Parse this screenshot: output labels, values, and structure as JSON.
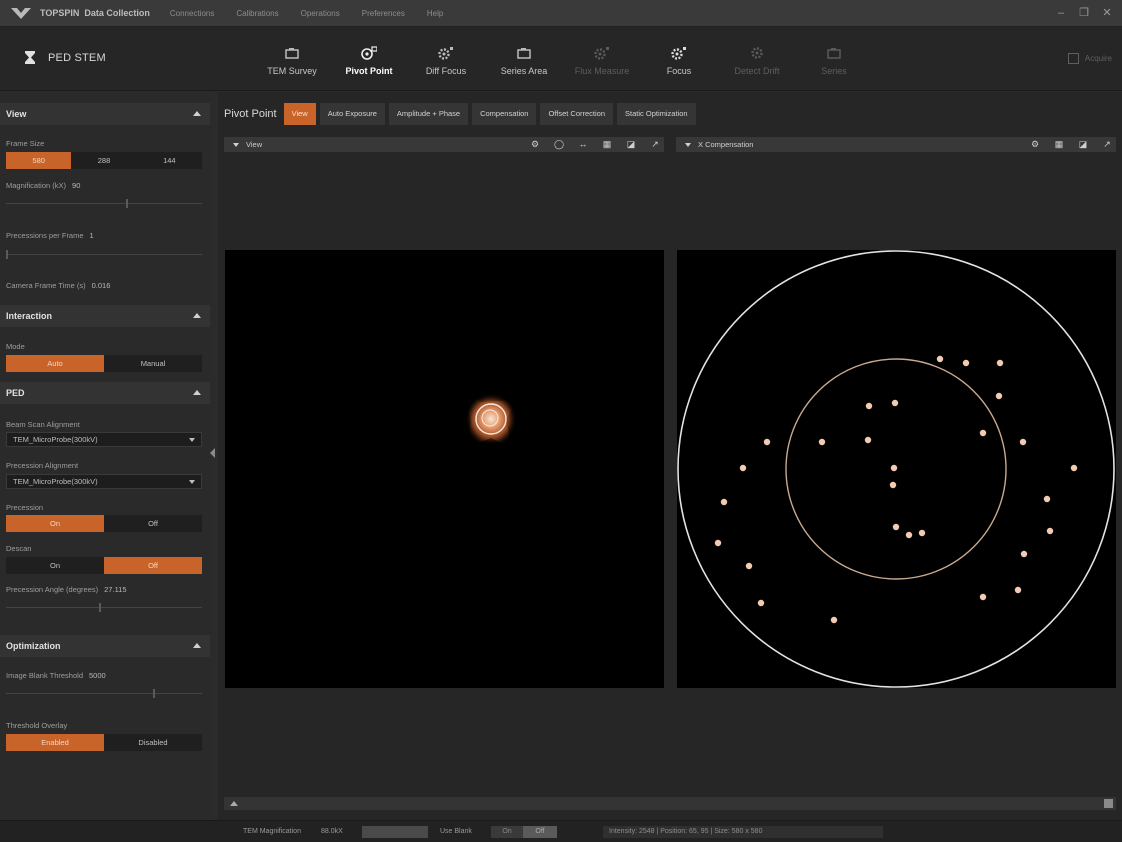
{
  "app": {
    "name": "TOPSPIN",
    "subtitle": "Data Collection"
  },
  "menu": [
    "Connections",
    "Calibrations",
    "Operations",
    "Preferences",
    "Help"
  ],
  "window_controls": [
    "minimize-icon",
    "restore-icon",
    "close-icon"
  ],
  "mode": {
    "label": "PED STEM"
  },
  "workflow": [
    {
      "label": "TEM Survey",
      "icon": "camera-icon",
      "state": "normal"
    },
    {
      "label": "Pivot Point",
      "icon": "target-camera-icon",
      "state": "active"
    },
    {
      "label": "Diff Focus",
      "icon": "gear-camera-icon",
      "state": "normal"
    },
    {
      "label": "Series Area",
      "icon": "camera-icon",
      "state": "normal"
    },
    {
      "label": "Flux Measure",
      "icon": "gear-camera-icon",
      "state": "disabled"
    },
    {
      "label": "Focus",
      "icon": "gear-camera-icon",
      "state": "normal"
    },
    {
      "label": "Detect Drift",
      "icon": "gear-icon",
      "state": "disabled"
    },
    {
      "label": "Series",
      "icon": "camera-icon",
      "state": "disabled"
    }
  ],
  "header_right": {
    "label": "Acquire"
  },
  "sidebar": {
    "view": {
      "title": "View",
      "frame_size_label": "Frame Size",
      "frame_sizes": [
        "580",
        "288",
        "144"
      ],
      "frame_size_selected": 0,
      "magnification_label": "Magnification (kX)",
      "magnification_value": "90",
      "magnification_fraction": 0.62,
      "precessions_label": "Precessions per Frame",
      "precessions_value": "1",
      "precessions_fraction": 0.0,
      "camera_frame_label": "Camera Frame Time (s)",
      "camera_frame_value": "0.016"
    },
    "interaction": {
      "title": "Interaction",
      "mode_label": "Mode",
      "modes": [
        "Auto",
        "Manual"
      ],
      "mode_selected": 0
    },
    "ped": {
      "title": "PED",
      "beam_scan_label": "Beam Scan Alignment",
      "beam_scan_value": "TEM_MicroProbe(300kV)",
      "precession_alignment_label": "Precession Alignment",
      "precession_alignment_value": "TEM_MicroProbe(300kV)",
      "precession_label": "Precession",
      "precession_options": [
        "On",
        "Off"
      ],
      "precession_selected": 0,
      "descan_label": "Descan",
      "descan_options": [
        "On",
        "Off"
      ],
      "descan_selected": 1,
      "angle_label": "Precession Angle (degrees)",
      "angle_value": "27.115",
      "angle_fraction": 0.48
    },
    "optimization": {
      "title": "Optimization",
      "threshold_label": "Image Blank Threshold",
      "threshold_value": "5000",
      "threshold_fraction": 0.76,
      "overlay_label": "Threshold Overlay",
      "overlay_options": [
        "Enabled",
        "Disabled"
      ],
      "overlay_selected": 0
    }
  },
  "main": {
    "title": "Pivot Point",
    "tabs": [
      "View",
      "Auto Exposure",
      "Amplitude + Phase",
      "Compensation",
      "Offset Correction",
      "Static Optimization"
    ],
    "tab_selected": 0,
    "left_panel": {
      "title": "View",
      "tools": [
        "gear-icon",
        "record-icon",
        "fit-width-icon",
        "grid-icon",
        "export-icon",
        "expand-icon"
      ]
    },
    "right_panel": {
      "title": "X Compensation",
      "tools": [
        "gear-icon",
        "grid-icon",
        "export-icon",
        "expand-icon"
      ]
    }
  },
  "statusbar": {
    "tem_mag_label": "TEM Magnification",
    "tem_mag_value": "88.0kX",
    "use_blank_label": "Use Blank",
    "use_blank_on": "On",
    "use_blank_off": "Off",
    "info": "Intensity: 2548 | Position: 65, 95 | Size: 580 x 580"
  },
  "colors": {
    "accent": "#c8642a",
    "dot": "#f3cbb5",
    "ring_inner": "#c9a98f",
    "ring_outer": "#e6e2de"
  }
}
